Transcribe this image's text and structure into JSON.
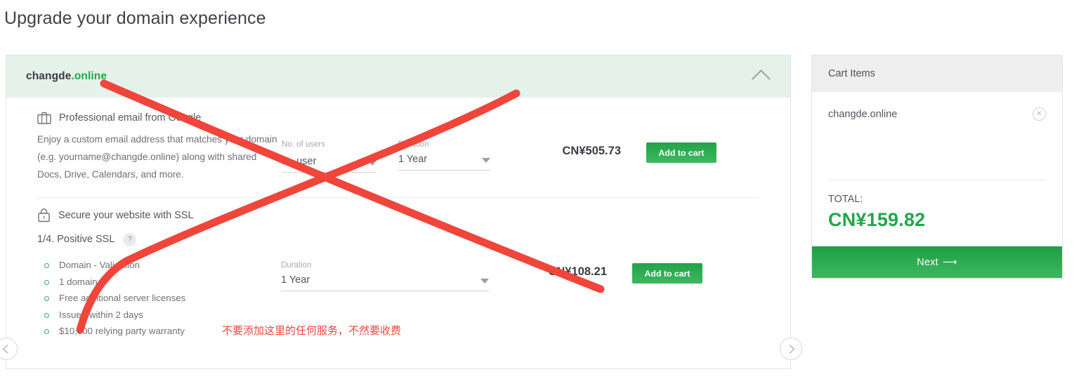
{
  "page": {
    "title": "Upgrade your domain experience"
  },
  "domain_card": {
    "domain_label": "changde",
    "domain_tld": ".online",
    "collapse_icon": "chevron-up-icon",
    "offers": [
      {
        "id": "email",
        "icon": "briefcase-icon",
        "title": "Professional email from Google",
        "description": "Enjoy a custom email address that matches your domain (e.g. yourname@changde.online) along with shared Docs, Drive, Calendars, and more.",
        "users_label": "No. of users",
        "users_value": "1",
        "users_unit": "user",
        "duration_label": "Duration",
        "duration_value": "1 Year",
        "price": "CN¥505.73",
        "add_to_cart": "Add to cart"
      },
      {
        "id": "ssl",
        "icon": "padlock-icon",
        "title": "Secure your website with SSL",
        "plan_name": "1/4. Positive SSL",
        "help_badge": "?",
        "features": [
          "Domain - Validation",
          "1 domain",
          "Free additional server licenses",
          "Issued within 2 days",
          "$10,000 relying party warranty"
        ],
        "duration_label": "Duration",
        "duration_value": "1 Year",
        "price": "CN¥108.21",
        "add_to_cart": "Add to cart"
      }
    ],
    "carousel": {
      "prev_icon": "chevron-left-icon",
      "next_icon": "chevron-right-icon"
    }
  },
  "cart": {
    "header": "Cart Items",
    "items": [
      {
        "name": "changde.online",
        "remove_icon": "close-circle-icon"
      }
    ],
    "total_label": "TOTAL:",
    "total_value": "CN¥159.82",
    "next_label": "Next",
    "next_arrow": "⟶"
  },
  "annotations": {
    "note_zh": "不要添加这里的任何服务，不然要收费",
    "cross_color": "#f0453a",
    "note_color": "#f0453a"
  },
  "colors": {
    "brand_green": "#21a84a",
    "header_green_bg": "#e4f2e9",
    "cart_header_bg": "#eeeeee"
  }
}
